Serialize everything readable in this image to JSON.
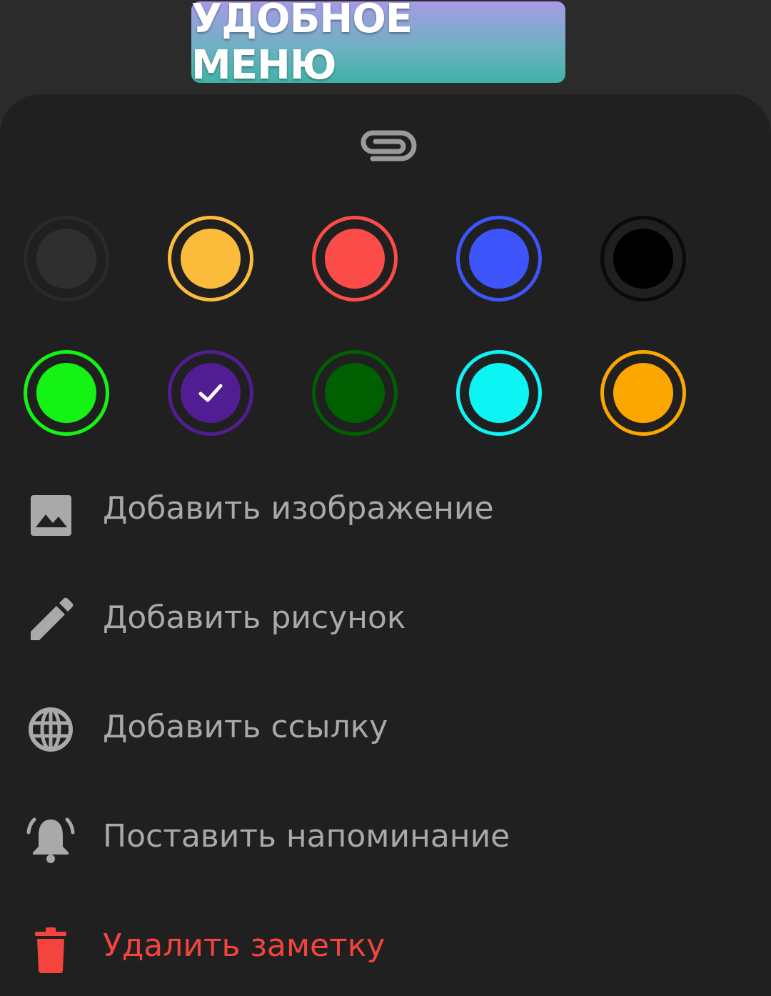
{
  "banner": {
    "title": "УДОБНОЕ МЕНЮ"
  },
  "sheet": {
    "attach_icon": "paperclip-icon",
    "colors": [
      {
        "name": "dark-gray",
        "fill": "#2f2f2f",
        "ring": "#2a2a2a",
        "selected": false
      },
      {
        "name": "yellow",
        "fill": "#fbbb3b",
        "ring": "#fbbb3b",
        "selected": false
      },
      {
        "name": "red",
        "fill": "#fc4c4a",
        "ring": "#fc4c4a",
        "selected": false
      },
      {
        "name": "blue",
        "fill": "#3d55fb",
        "ring": "#3d55fb",
        "selected": false
      },
      {
        "name": "black",
        "fill": "#000000",
        "ring": "#0a0a0a",
        "selected": false
      },
      {
        "name": "green",
        "fill": "#14f314",
        "ring": "#14f314",
        "selected": false
      },
      {
        "name": "purple",
        "fill": "#521d93",
        "ring": "#521d93",
        "selected": true
      },
      {
        "name": "dark-green",
        "fill": "#005f00",
        "ring": "#005f00",
        "selected": false
      },
      {
        "name": "cyan",
        "fill": "#0cf4f4",
        "ring": "#0cf4f4",
        "selected": false
      },
      {
        "name": "orange",
        "fill": "#fca600",
        "ring": "#fca600",
        "selected": false
      }
    ],
    "menu": [
      {
        "label": "Добавить изображение",
        "icon": "image-icon"
      },
      {
        "label": "Добавить рисунок",
        "icon": "pencil-icon"
      },
      {
        "label": "Добавить ссылку",
        "icon": "globe-icon"
      },
      {
        "label": "Поставить напоминание",
        "icon": "bell-icon"
      },
      {
        "label": "Удалить заметку",
        "icon": "trash-icon"
      }
    ]
  }
}
